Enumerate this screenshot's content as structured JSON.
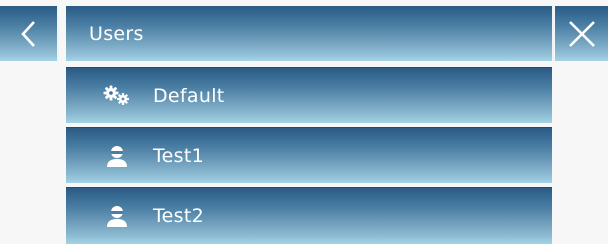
{
  "header": {
    "title": "Users",
    "back_icon": "chevron-left-icon",
    "close_icon": "close-icon"
  },
  "users": [
    {
      "label": "Default",
      "icon": "gears-icon"
    },
    {
      "label": "Test1",
      "icon": "user-icon"
    },
    {
      "label": "Test2",
      "icon": "user-icon"
    }
  ],
  "colors": {
    "bar_top": "#2c5a84",
    "bar_bottom": "#a4d3e6",
    "background": "#f7f7f7",
    "text": "#ffffff"
  }
}
